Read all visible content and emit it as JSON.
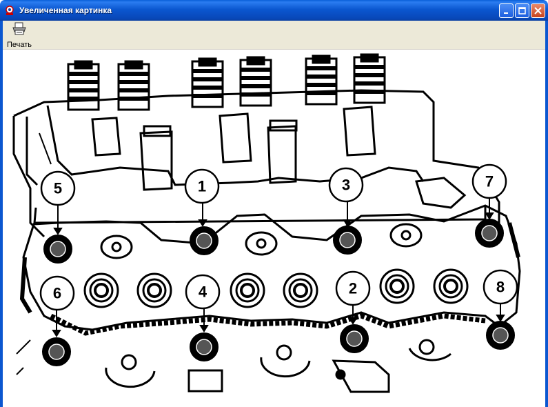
{
  "window": {
    "title": "Увеличенная картинка"
  },
  "toolbar": {
    "print_label": "Печать",
    "print_icon": "printer-icon"
  },
  "diagram": {
    "callouts": [
      "1",
      "2",
      "3",
      "4",
      "5",
      "6",
      "7",
      "8"
    ]
  },
  "colors": {
    "titlebar": "#0b57d0",
    "toolbar_bg": "#ece9d8",
    "close_button": "#c8431e"
  }
}
